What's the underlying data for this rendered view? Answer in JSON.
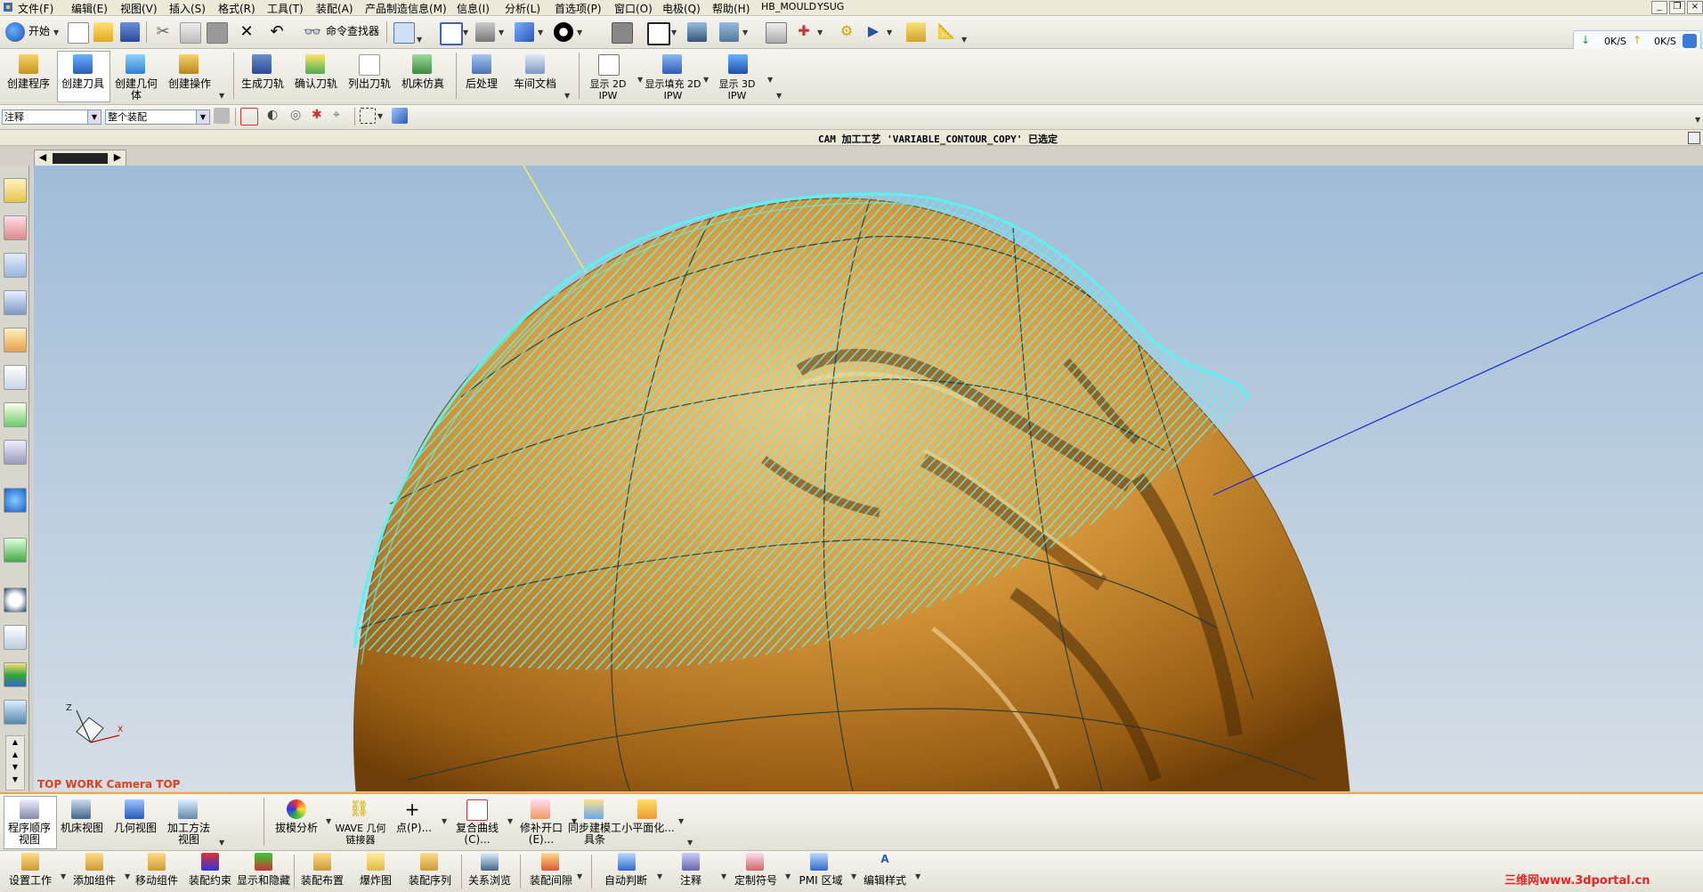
{
  "menu": [
    "文件(F)",
    "编辑(E)",
    "视图(V)",
    "插入(S)",
    "格式(R)",
    "工具(T)",
    "装配(A)",
    "产品制造信息(M)",
    "信息(I)",
    "分析(L)",
    "首选项(P)",
    "窗口(O)",
    "电极(Q)",
    "帮助(H)",
    "HB_MOULD",
    "YSUG"
  ],
  "toolbar1": {
    "start_label": "开始",
    "command_finder_label": "命令查找器"
  },
  "net": {
    "down": "0K/S",
    "up": "0K/S"
  },
  "cam_toolbar": [
    "创建程序",
    "创建刀具",
    "创建几何体",
    "创建操作",
    "生成刀轨",
    "确认刀轨",
    "列出刀轨",
    "机床仿真",
    "后处理",
    "车间文档",
    "显示 2D IPW",
    "显示填充 2D IPW",
    "显示 3D IPW"
  ],
  "filters": {
    "type_filter": "注释",
    "scope": "整个装配"
  },
  "status": {
    "message": "CAM 加工工艺 'VARIABLE_CONTOUR_COPY' 已选定"
  },
  "viewport": {
    "camera_label": "TOP WORK Camera TOP"
  },
  "bottom_row1": [
    "程序顺序视图",
    "机床视图",
    "几何视图",
    "加工方法视图",
    "拔模分析",
    "WAVE 几何链接器",
    "点(P)...",
    "复合曲线(C)...",
    "修补开口(E)...",
    "同步建模工具条",
    "小平面化..."
  ],
  "bottom_row2": [
    "设置工作",
    "添加组件",
    "移动组件",
    "装配约束",
    "显示和隐藏",
    "装配布置",
    "爆炸图",
    "装配序列",
    "关系浏览",
    "装配间隙",
    "自动判断",
    "注释",
    "定制符号",
    "PMI 区域",
    "编辑样式"
  ],
  "watermark": "三维网www.3dportal.cn",
  "colors": {
    "toolpath": "#5ef2ee",
    "model": "#c98a2e",
    "background_top": "#9fbcd8",
    "background_bottom": "#d5dee6",
    "accent_orange": "#f2a64a"
  }
}
